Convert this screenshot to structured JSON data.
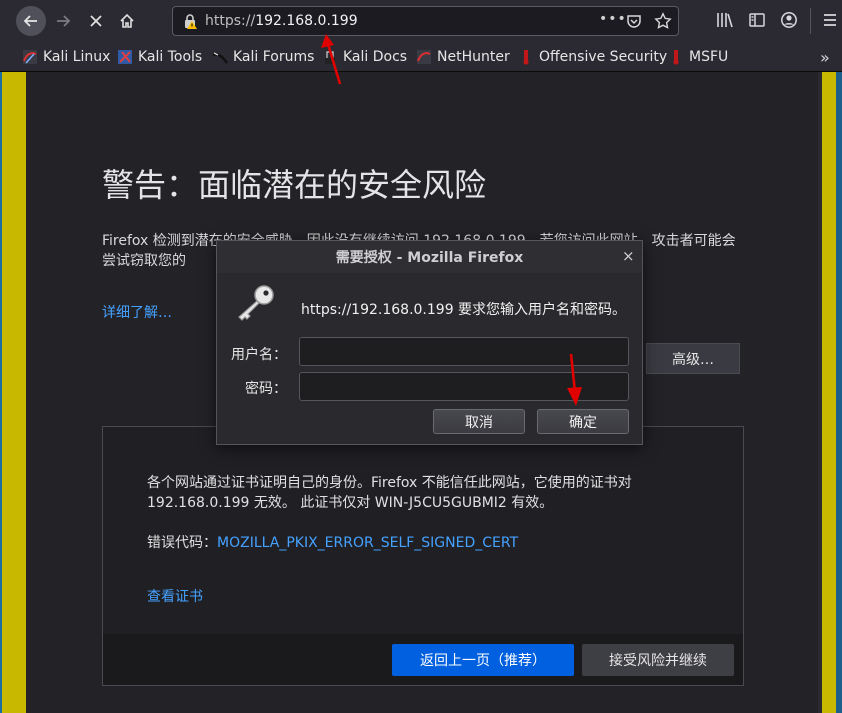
{
  "browser": {
    "url_scheme": "https://",
    "url_host": "192.168.0.199",
    "url_more": "•••"
  },
  "bookmarks": [
    {
      "label": "Kali Linux",
      "icon": "kali-dragon-icon"
    },
    {
      "label": "Kali Tools",
      "icon": "kali-tools-icon"
    },
    {
      "label": "Kali Forums",
      "icon": "kali-forums-icon"
    },
    {
      "label": "Kali Docs",
      "icon": "kali-docs-icon"
    },
    {
      "label": "NetHunter",
      "icon": "nethunter-icon"
    },
    {
      "label": "Offensive Security",
      "icon": "offsec-icon"
    },
    {
      "label": "MSFU",
      "icon": "msfu-icon"
    }
  ],
  "warning": {
    "title": "警告：面临潜在的安全风险",
    "description": "Firefox 检测到潜在的安全威胁，因此没有继续访问 192.168.0.199。若您访问此网站，攻击者可能会尝试窃取您的",
    "learn_more": "详细了解…",
    "advanced_button": "高级…",
    "advanced_text": "各个网站通过证书证明自己的身份。Firefox 不能信任此网站，它使用的证书对 192.168.0.199 无效。 此证书仅对 WIN-J5CU5GUBMI2 有效。",
    "error_label": "错误代码：",
    "error_code": "MOZILLA_PKIX_ERROR_SELF_SIGNED_CERT",
    "view_certificate": "查看证书",
    "go_back_button": "返回上一页（推荐）",
    "accept_button": "接受风险并继续"
  },
  "dialog": {
    "title": "需要授权 - Mozilla Firefox",
    "close": "×",
    "message": "https://192.168.0.199 要求您输入用户名和密码。",
    "username_label": "用户名：",
    "password_label": "密码：",
    "username_value": "",
    "password_value": "",
    "cancel_button": "取消",
    "ok_button": "确定"
  },
  "colors": {
    "accent_blue": "#0060df",
    "link_blue": "#45a1ff",
    "annotation_red": "#e00000",
    "desktop_yellow": "#c8b900"
  }
}
